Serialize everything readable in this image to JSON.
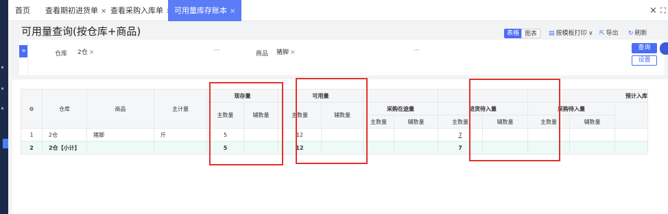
{
  "tabs": [
    {
      "label": "首页",
      "close": ""
    },
    {
      "label": "查看期初进货单",
      "close": "×"
    },
    {
      "label": "查看采购入库单",
      "close": "×"
    },
    {
      "label": "可用量库存账本",
      "close": "×"
    }
  ],
  "window": {
    "close": "×",
    "fullscreen": "⛶"
  },
  "page": {
    "title": "可用量查询(按仓库+商品)",
    "view_table": "表格",
    "view_chart": "图表",
    "print": "按模板打印",
    "print_arrow": "∨",
    "export": "导出",
    "refresh": "刷新"
  },
  "filter": {
    "expander": "»",
    "warehouse_label": "仓库",
    "warehouse_value": "2仓",
    "product_label": "商品",
    "product_value": "猪脚",
    "tag_close": "×",
    "more": "···",
    "query_button": "查询",
    "settings_button": "设置"
  },
  "table": {
    "settings_icon": "⚙",
    "col_warehouse": "仓库",
    "col_product": "商品",
    "col_unit": "主计量",
    "grp_stock": "现存量",
    "grp_available": "可用量",
    "grp_in_transit": "采购在途量",
    "grp_pending_in": "进货待入量",
    "grp_purchase_pending": "采购待入量",
    "grp_expected": "预计入库",
    "sub_main": "主数量",
    "sub_aux": "辅数量",
    "rows": [
      {
        "idx": "1",
        "warehouse": "2仓",
        "product": "猪脚",
        "unit": "斤",
        "stock_main": "5",
        "available_main": "12",
        "pending_in_main": "7"
      },
      {
        "idx": "2",
        "warehouse": "2仓【小计】",
        "product": "",
        "unit": "",
        "stock_main": "5",
        "available_main": "12",
        "pending_in_main": "7"
      }
    ]
  }
}
